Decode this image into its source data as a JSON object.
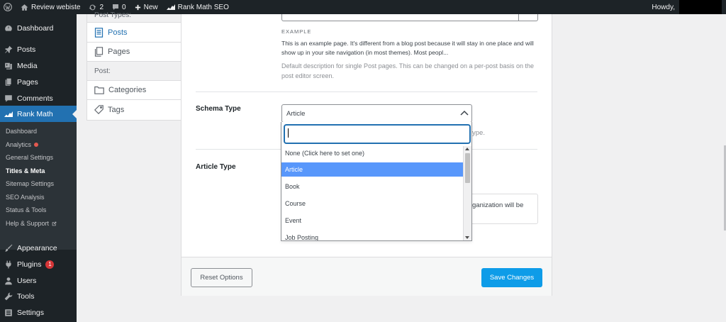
{
  "adminbar": {
    "site_name": "Review webiste",
    "updates_count": "2",
    "comments_count": "0",
    "new_label": "New",
    "plugin_label": "Rank Math SEO",
    "howdy": "Howdy,"
  },
  "sidebar": {
    "items": [
      {
        "label": "Dashboard",
        "icon": "dashboard-icon"
      },
      {
        "label": "Posts",
        "icon": "pin-icon"
      },
      {
        "label": "Media",
        "icon": "media-icon"
      },
      {
        "label": "Pages",
        "icon": "pages-icon"
      },
      {
        "label": "Comments",
        "icon": "comment-icon"
      },
      {
        "label": "Rank Math",
        "icon": "rankmath-icon"
      },
      {
        "label": "Appearance",
        "icon": "brush-icon"
      },
      {
        "label": "Plugins",
        "icon": "plugin-icon",
        "badge": "1"
      },
      {
        "label": "Users",
        "icon": "users-icon"
      },
      {
        "label": "Tools",
        "icon": "wrench-icon"
      },
      {
        "label": "Settings",
        "icon": "settings-icon"
      }
    ],
    "submenu": [
      {
        "label": "Dashboard"
      },
      {
        "label": "Analytics"
      },
      {
        "label": "General Settings"
      },
      {
        "label": "Titles & Meta"
      },
      {
        "label": "Sitemap Settings"
      },
      {
        "label": "SEO Analysis"
      },
      {
        "label": "Status & Tools"
      },
      {
        "label": "Help & Support"
      }
    ]
  },
  "tabs": {
    "post_types_header": "Post Types:",
    "posts": "Posts",
    "pages": "Pages",
    "post_header": "Post:",
    "categories": "Categories",
    "tags": "Tags"
  },
  "main": {
    "example_label": "EXAMPLE",
    "example_text": "This is an example page. It's different from a blog post because it will stay in one place and will show up in your site navigation (in most themes). Most peopl...",
    "description": "Default description for single Post pages. This can be changed on a per-post basis on the post editor screen.",
    "schema_type_label": "Schema Type",
    "schema_type_value": "Article",
    "behind_text_1": "ype.",
    "article_type_label": "Article Type",
    "behind_text_2": "ganization will be",
    "reset_label": "Reset Options",
    "save_label": "Save Changes"
  },
  "dropdown": {
    "search_value": "",
    "options": [
      "None (Click here to set one)",
      "Article",
      "Book",
      "Course",
      "Event",
      "Job Posting"
    ],
    "highlighted": "Article"
  }
}
